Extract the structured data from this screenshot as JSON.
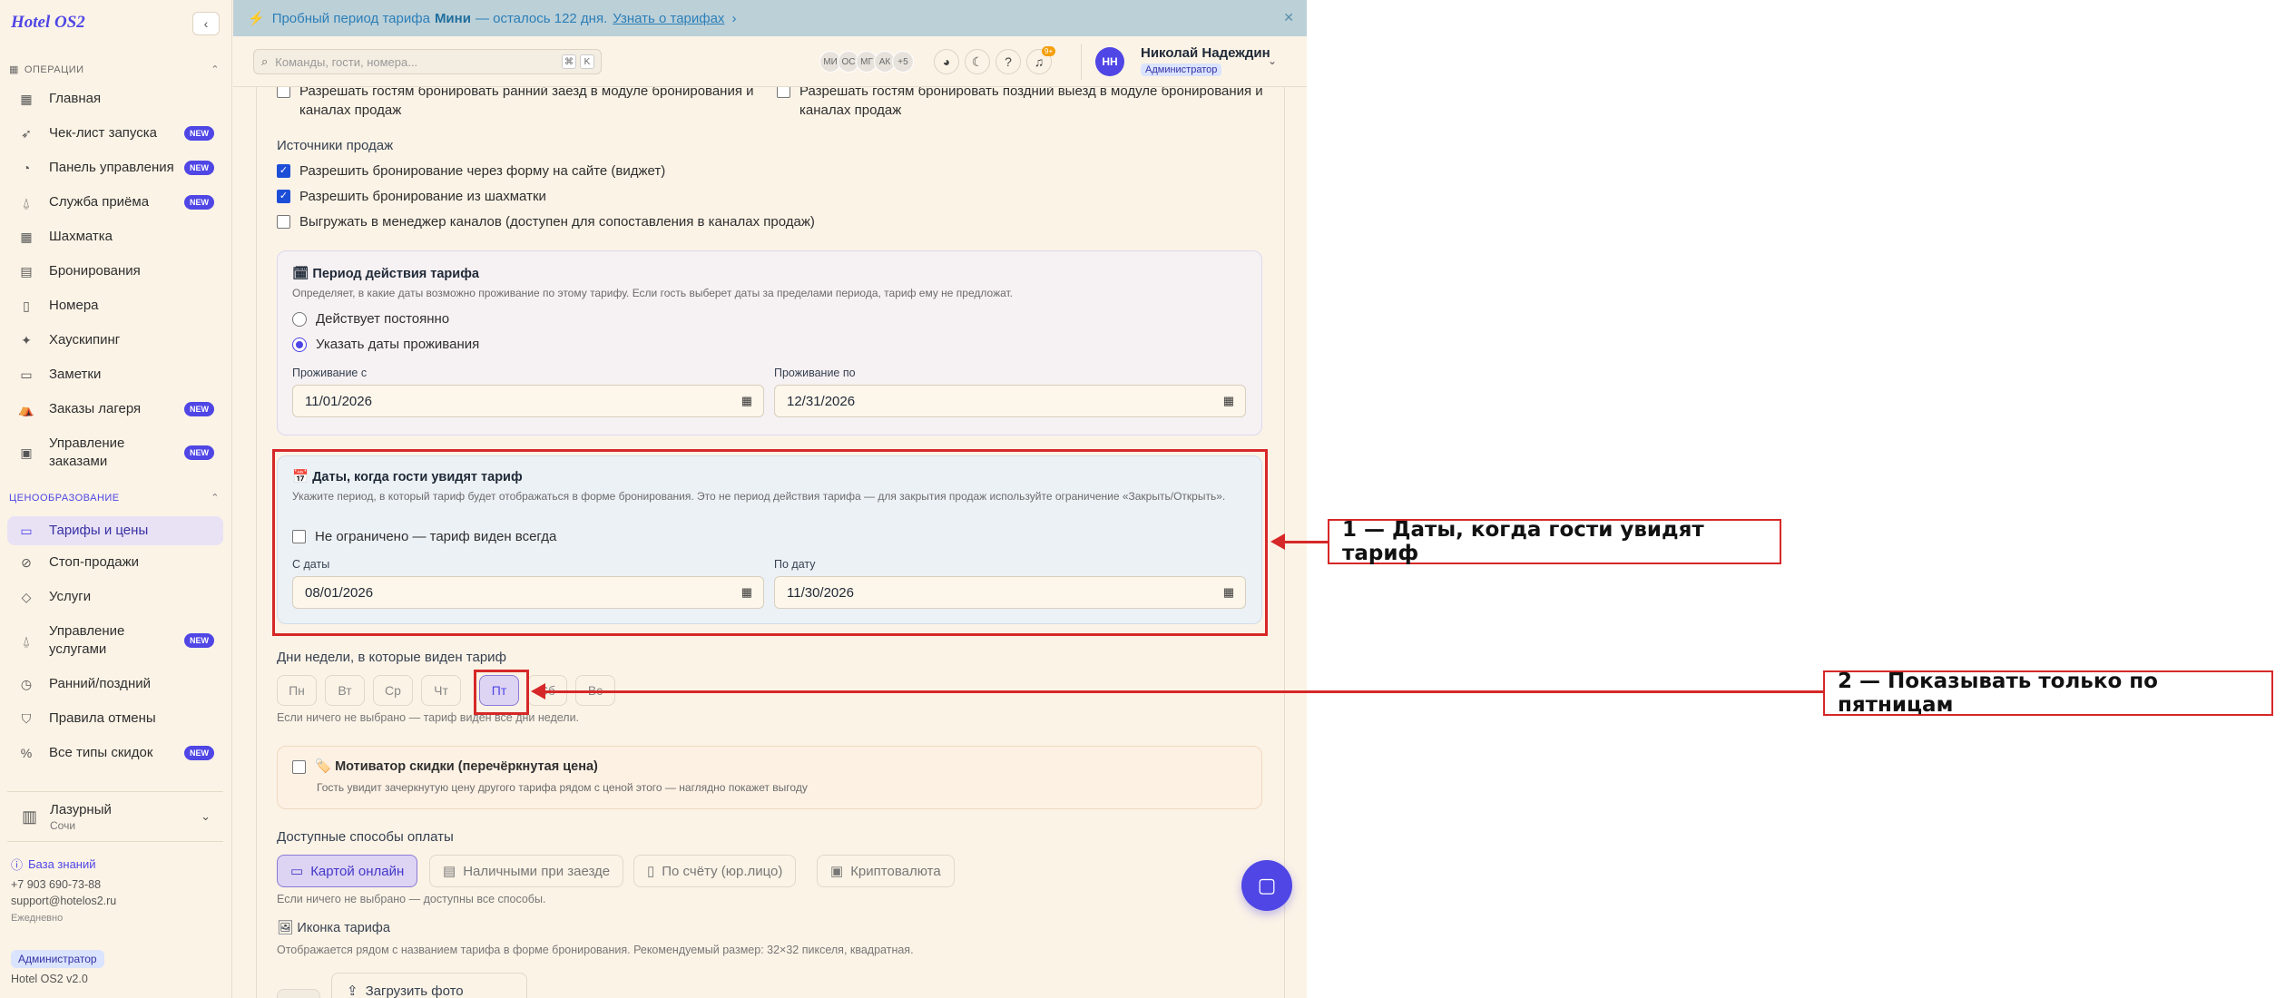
{
  "app": {
    "logo": "Hotel OS2"
  },
  "banner": {
    "prefix": "Пробный период тарифа",
    "plan": "Мини",
    "suffix": "— осталось 122 дня.",
    "link": "Узнать о тарифах"
  },
  "search": {
    "placeholder": "Команды, гости, номера..."
  },
  "topbar": {
    "avatars": [
      "МИ",
      "ОС",
      "МГ",
      "АК",
      "+5"
    ],
    "notif_count": "9+"
  },
  "user": {
    "initials": "НН",
    "name": "Николай Надеждин",
    "role": "Администратор"
  },
  "sidebar": {
    "section_ops": "Операции",
    "items": [
      {
        "label": "Главная",
        "icon": "grid-icon"
      },
      {
        "label": "Чек-лист запуска",
        "icon": "rocket-icon",
        "badge": "NEW"
      },
      {
        "label": "Панель управления",
        "icon": "gauge-icon",
        "badge": "NEW"
      },
      {
        "label": "Служба приёма",
        "icon": "bell-icon",
        "badge": "NEW"
      },
      {
        "label": "Шахматка",
        "icon": "table-icon"
      },
      {
        "label": "Бронирования",
        "icon": "book-icon"
      },
      {
        "label": "Номера",
        "icon": "door-icon"
      },
      {
        "label": "Хаускипинг",
        "icon": "sparkle-icon"
      },
      {
        "label": "Заметки",
        "icon": "note-icon"
      },
      {
        "label": "Заказы лагеря",
        "icon": "tent-icon",
        "badge": "NEW"
      },
      {
        "label": "Управление заказами",
        "icon": "clipboard-icon",
        "badge": "NEW"
      }
    ],
    "section_pricing": "Ценообразование",
    "pricing_items": [
      {
        "label": "Тарифы и цены",
        "icon": "card-icon"
      },
      {
        "label": "Стоп-продажи",
        "icon": "ban-icon"
      },
      {
        "label": "Услуги",
        "icon": "tag-icon"
      },
      {
        "label": "Управление услугами",
        "icon": "bell-icon",
        "badge": "NEW"
      },
      {
        "label": "Ранний/поздний",
        "icon": "clock-icon"
      },
      {
        "label": "Правила отмены",
        "icon": "shield-icon"
      },
      {
        "label": "Все типы скидок",
        "icon": "percent-icon",
        "badge": "NEW"
      }
    ],
    "hotel": {
      "name": "Лазурный",
      "city": "Сочи"
    },
    "knowledge_base": "База знаний",
    "phone": "+7 903 690-73-88",
    "email": "support@hotelos2.ru",
    "schedule": "Ежедневно",
    "role": "Администратор",
    "version": "Hotel OS2 v2.0"
  },
  "form": {
    "early_checkin": "Разрешать гостям бронировать ранний заезд в модуле бронирования и каналах продаж",
    "late_checkout": "Разрешать гостям бронировать поздний выезд в модуле бронирования и каналах продаж",
    "sales_sources_title": "Источники продаж",
    "source_widget": "Разрешить бронирование через форму на сайте (виджет)",
    "source_chess": "Разрешить бронирование из шахматки",
    "source_channel": "Выгружать в менеджер каналов (доступен для сопоставления в каналах продаж)",
    "validity": {
      "title": "🗓 Период действия тарифа",
      "desc": "Определяет, в какие даты возможно проживание по этому тарифу. Если гость выберет даты за пределами периода, тариф ему не предложат.",
      "opt_always": "Действует постоянно",
      "opt_dates": "Указать даты проживания",
      "from_label": "Проживание с",
      "from_value": "11/01/2026",
      "to_label": "Проживание по",
      "to_value": "12/31/2026"
    },
    "visibility": {
      "title": "📅 Даты, когда гости увидят тариф",
      "desc": "Укажите период, в который тариф будет отображаться в форме бронирования. Это не период действия тарифа — для закрытия продаж используйте ограничение «Закрыть/Открыть».",
      "unlimited": "Не ограничено — тариф виден всегда",
      "from_label": "С даты",
      "from_value": "08/01/2026",
      "to_label": "По дату",
      "to_value": "11/30/2026"
    },
    "weekdays_title": "Дни недели, в которые виден тариф",
    "weekdays": [
      "Пн",
      "Вт",
      "Ср",
      "Чт",
      "Пт",
      "Сб",
      "Вс"
    ],
    "weekdays_hint": "Если ничего не выбрано — тариф виден все дни недели.",
    "motivator": {
      "title": "🏷️ Мотиватор скидки (перечёркнутая цена)",
      "desc": "Гость увидит зачеркнутую цену другого тарифа рядом с ценой этого — наглядно покажет выгоду"
    },
    "payment_title": "Доступные способы оплаты",
    "payments": [
      "Картой онлайн",
      "Наличными при заезде",
      "По счёту (юр.лицо)",
      "Криптовалюта"
    ],
    "payment_hint": "Если ничего не выбрано — доступны все способы.",
    "icon_title": "🖼 Иконка тарифа",
    "icon_desc": "Отображается рядом с названием тарифа в форме бронирования. Рекомендуемый размер: 32×32 пикселя, квадратная.",
    "upload": "Загрузить фото"
  },
  "annotations": {
    "one": "1 — Даты, когда гости увидят тариф",
    "two": "2 — Показывать только по пятницам"
  },
  "colors": {
    "accent": "#4f46e5",
    "annotation": "#d62828",
    "banner": "#bcd0d8"
  }
}
